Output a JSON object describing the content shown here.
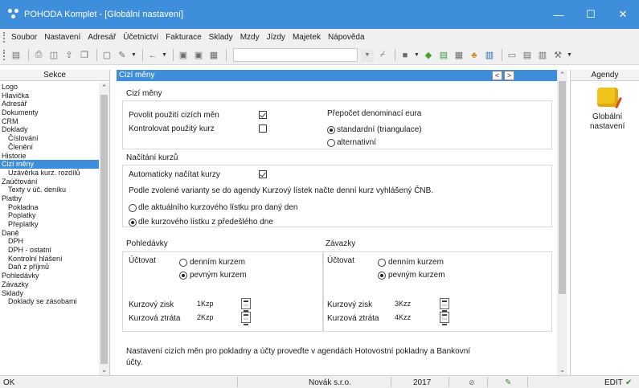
{
  "window": {
    "title": "POHODA Komplet - [Globální nastavení]",
    "controls": {
      "minimize": "—",
      "maximize": "☐",
      "close": "✕"
    }
  },
  "menu": [
    {
      "label": "Soubor"
    },
    {
      "label": "Nastavení"
    },
    {
      "label": "Adresář"
    },
    {
      "label": "Účetnictví"
    },
    {
      "label": "Fakturace"
    },
    {
      "label": "Sklady"
    },
    {
      "label": "Mzdy"
    },
    {
      "label": "Jízdy"
    },
    {
      "label": "Majetek"
    },
    {
      "label": "Nápověda"
    }
  ],
  "sections_panel": {
    "header": "Sekce",
    "items": [
      {
        "label": "Logo",
        "level": 1
      },
      {
        "label": "Hlavička",
        "level": 1
      },
      {
        "label": "Adresář",
        "level": 1
      },
      {
        "label": "Dokumenty",
        "level": 1
      },
      {
        "label": "CRM",
        "level": 1
      },
      {
        "label": "Doklady",
        "level": 1
      },
      {
        "label": "Číslování",
        "level": 2
      },
      {
        "label": "Členění",
        "level": 2
      },
      {
        "label": "Historie",
        "level": 1
      },
      {
        "label": "Cizí měny",
        "level": 1,
        "active": true
      },
      {
        "label": "Uzávěrka kurz. rozdílů",
        "level": 2
      },
      {
        "label": "Zaúčtování",
        "level": 1
      },
      {
        "label": "Texty v úč. deníku",
        "level": 2
      },
      {
        "label": "Platby",
        "level": 1
      },
      {
        "label": "Pokladna",
        "level": 2
      },
      {
        "label": "Poplatky",
        "level": 2
      },
      {
        "label": "Přeplatky",
        "level": 2
      },
      {
        "label": "Daně",
        "level": 1
      },
      {
        "label": "DPH",
        "level": 2
      },
      {
        "label": "DPH - ostatní",
        "level": 2
      },
      {
        "label": "Kontrolní hlášení",
        "level": 2
      },
      {
        "label": "Daň z příjmů",
        "level": 2
      },
      {
        "label": "Pohledávky",
        "level": 1
      },
      {
        "label": "Závazky",
        "level": 1
      },
      {
        "label": "Sklady",
        "level": 1
      },
      {
        "label": "Doklady se zásobami",
        "level": 2
      }
    ]
  },
  "main": {
    "header": "Cizí měny",
    "nav_prev": "<",
    "nav_next": ">",
    "cizi_meny": {
      "title": "Cizí měny",
      "povolit_label": "Povolit použití cizích měn",
      "povolit_checked": true,
      "kontrolovat_label": "Kontrolovat použitý kurz",
      "kontrolovat_checked": false,
      "prepocet_title": "Přepočet denominací eura",
      "prepocet_options": [
        "standardní (triangulace)",
        "alternativní"
      ],
      "prepocet_selected": 0
    },
    "nacitani": {
      "title": "Načítání kurzů",
      "auto_label": "Automaticky načítat kurzy",
      "auto_checked": true,
      "description": "Podle zvolené varianty se do agendy Kurzový lístek načte denní kurz vyhlášený ČNB.",
      "options": [
        "dle aktuálního kurzového lístku pro daný den",
        "dle kurzového lístku z předešlého dne"
      ],
      "selected": 1
    },
    "pohledavky": {
      "title": "Pohledávky",
      "uctovat_label": "Účtovat",
      "options": [
        "denním kurzem",
        "pevným kurzem"
      ],
      "selected": 1,
      "zisk_label": "Kurzový zisk",
      "zisk_value": "1Kzp",
      "ztrata_label": "Kurzová ztráta",
      "ztrata_value": "2Kzp"
    },
    "zavazky": {
      "title": "Závazky",
      "uctovat_label": "Účtovat",
      "options": [
        "denním kurzem",
        "pevným kurzem"
      ],
      "selected": 1,
      "zisk_label": "Kurzový zisk",
      "zisk_value": "3Kzz",
      "ztrata_label": "Kurzová ztráta",
      "ztrata_value": "4Kzz"
    },
    "footer_note_line1": "Nastavení cizích měn pro pokladny a účty proveďte v agendách Hotovostní pokladny a Bankovní",
    "footer_note_line2": "účty."
  },
  "agendy_panel": {
    "header": "Agendy",
    "item_line1": "Globální",
    "item_line2": "nastavení"
  },
  "status": {
    "left": "OK",
    "company": "Novák s.r.o.",
    "year": "2017",
    "mode": "EDIT"
  },
  "colors": {
    "accent": "#3f8edb",
    "chrome": "#f0f0f0"
  }
}
